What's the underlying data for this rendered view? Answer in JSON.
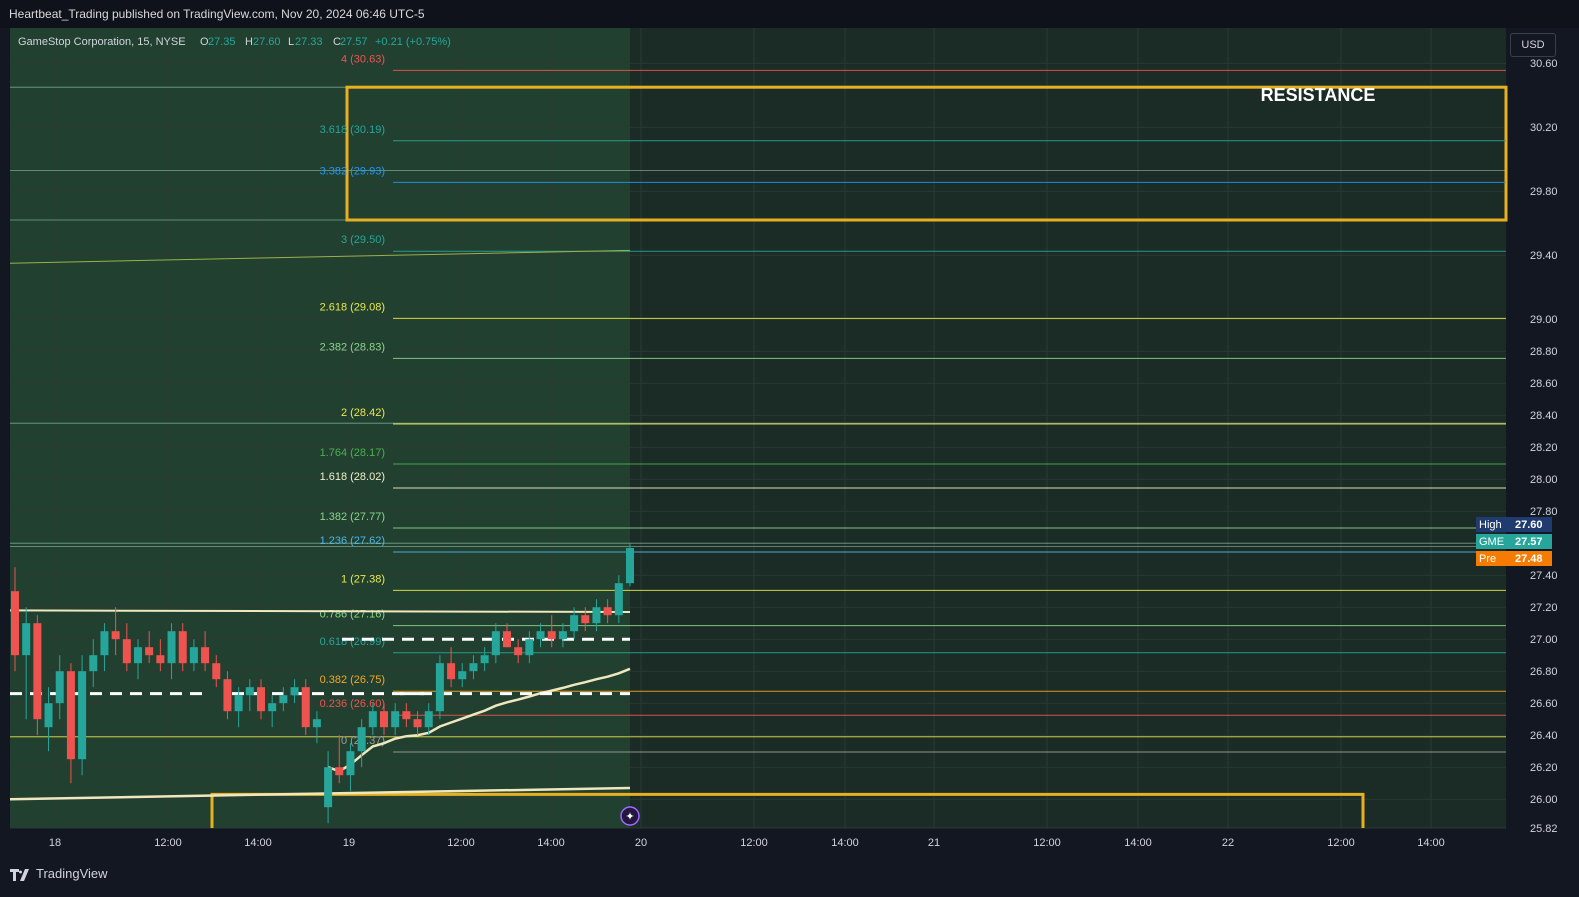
{
  "header": {
    "publisher_line": "Heartbeat_Trading published on TradingView.com, Nov 20, 2024 06:46 UTC-5"
  },
  "legend": {
    "symbol": "GameStop Corporation, 15, NYSE",
    "o_label": "O",
    "o_value": "27.35",
    "h_label": "H",
    "h_value": "27.60",
    "l_label": "L",
    "l_value": "27.33",
    "c_label": "C",
    "c_value": "27.57",
    "change": "+0.21 (+0.75%)"
  },
  "currency_button": "USD",
  "footer": {
    "brand": "TradingView"
  },
  "annotation": {
    "text": "RESISTANCE"
  },
  "colors": {
    "background": "#1b2b26",
    "shade_left": "#224232",
    "up": "#26a69a",
    "down": "#ef5350",
    "box": "#e8b020",
    "vwap": "#efe7bd"
  },
  "chart_data": {
    "type": "candlestick",
    "symbol": "GME",
    "interval": "15",
    "ylim": [
      25.82,
      30.82
    ],
    "y_ticks": [
      "30.60",
      "30.20",
      "29.80",
      "29.40",
      "29.00",
      "28.80",
      "28.60",
      "28.40",
      "28.20",
      "28.00",
      "27.80",
      "27.40",
      "27.20",
      "27.00",
      "26.80",
      "26.60",
      "26.40",
      "26.20",
      "26.00",
      "25.82"
    ],
    "x_ticks": [
      "18",
      "12:00",
      "14:00",
      "19",
      "12:00",
      "14:00",
      "20",
      "12:00",
      "14:00",
      "21",
      "12:00",
      "14:00",
      "22",
      "12:00",
      "14:00"
    ],
    "price_tags": [
      {
        "label": "High",
        "value": "27.60",
        "color": "#1f3b70"
      },
      {
        "label": "GME",
        "value": "27.57",
        "color": "#26a69a"
      },
      {
        "label": "Pre",
        "value": "27.48",
        "color": "#f57c00"
      }
    ],
    "fib_levels": [
      {
        "ratio": "4",
        "price": 30.63,
        "text": "4 (30.63)",
        "color": "#ef5350"
      },
      {
        "ratio": "3.618",
        "price": 30.19,
        "text": "3.618 (30.19)",
        "color": "#26a69a"
      },
      {
        "ratio": "3.382",
        "price": 29.93,
        "text": "3.382 (29.93)",
        "color": "#2196f3"
      },
      {
        "ratio": "3",
        "price": 29.5,
        "text": "3 (29.50)",
        "color": "#26a69a"
      },
      {
        "ratio": "2.618",
        "price": 29.08,
        "text": "2.618 (29.08)",
        "color": "#e8e84a"
      },
      {
        "ratio": "2.382",
        "price": 28.83,
        "text": "2.382 (28.83)",
        "color": "#8bd48b"
      },
      {
        "ratio": "2",
        "price": 28.42,
        "text": "2 (28.42)",
        "color": "#e8e84a"
      },
      {
        "ratio": "1.764",
        "price": 28.17,
        "text": "1.764 (28.17)",
        "color": "#4caf50"
      },
      {
        "ratio": "1.618",
        "price": 28.02,
        "text": "1.618 (28.02)",
        "color": "#f0f0c8"
      },
      {
        "ratio": "1.382",
        "price": 27.77,
        "text": "1.382 (27.77)",
        "color": "#8bd48b"
      },
      {
        "ratio": "1.236",
        "price": 27.62,
        "text": "1.236 (27.62)",
        "color": "#4db6e8"
      },
      {
        "ratio": "1",
        "price": 27.38,
        "text": "1 (27.38)",
        "color": "#e8e84a"
      },
      {
        "ratio": "0.786",
        "price": 27.16,
        "text": "0.786 (27.16)",
        "color": "#8bd48b"
      },
      {
        "ratio": "0.618",
        "price": 26.99,
        "text": "0.618 (26.99)",
        "color": "#26a69a"
      },
      {
        "ratio": "0.382",
        "price": 26.75,
        "text": "0.382 (26.75)",
        "color": "#f5a623"
      },
      {
        "ratio": "0.236",
        "price": 26.6,
        "text": "0.236 (26.60)",
        "color": "#ef5350"
      },
      {
        "ratio": "0",
        "price": 26.37,
        "text": "0 (26.37)",
        "color": "#9e9e9e"
      }
    ],
    "candles": [
      {
        "o": 27.3,
        "h": 27.45,
        "l": 26.8,
        "c": 26.9
      },
      {
        "o": 26.9,
        "h": 27.2,
        "l": 26.5,
        "c": 27.1
      },
      {
        "o": 27.1,
        "h": 27.15,
        "l": 26.4,
        "c": 26.5
      },
      {
        "o": 26.45,
        "h": 26.7,
        "l": 26.3,
        "c": 26.6
      },
      {
        "o": 26.6,
        "h": 26.9,
        "l": 26.5,
        "c": 26.8
      },
      {
        "o": 26.8,
        "h": 26.85,
        "l": 26.1,
        "c": 26.25
      },
      {
        "o": 26.25,
        "h": 26.9,
        "l": 26.15,
        "c": 26.8
      },
      {
        "o": 26.8,
        "h": 27.0,
        "l": 26.7,
        "c": 26.9
      },
      {
        "o": 26.9,
        "h": 27.1,
        "l": 26.8,
        "c": 27.05
      },
      {
        "o": 27.05,
        "h": 27.2,
        "l": 26.9,
        "c": 27.0
      },
      {
        "o": 27.0,
        "h": 27.1,
        "l": 26.8,
        "c": 26.85
      },
      {
        "o": 26.85,
        "h": 27.0,
        "l": 26.75,
        "c": 26.95
      },
      {
        "o": 26.95,
        "h": 27.05,
        "l": 26.85,
        "c": 26.9
      },
      {
        "o": 26.9,
        "h": 27.0,
        "l": 26.8,
        "c": 26.85
      },
      {
        "o": 26.85,
        "h": 27.1,
        "l": 26.75,
        "c": 27.05
      },
      {
        "o": 27.05,
        "h": 27.1,
        "l": 26.8,
        "c": 26.85
      },
      {
        "o": 26.85,
        "h": 27.0,
        "l": 26.8,
        "c": 26.95
      },
      {
        "o": 26.95,
        "h": 27.05,
        "l": 26.8,
        "c": 26.85
      },
      {
        "o": 26.85,
        "h": 26.9,
        "l": 26.7,
        "c": 26.75
      },
      {
        "o": 26.75,
        "h": 26.8,
        "l": 26.5,
        "c": 26.55
      },
      {
        "o": 26.55,
        "h": 26.7,
        "l": 26.45,
        "c": 26.65
      },
      {
        "o": 26.65,
        "h": 26.75,
        "l": 26.55,
        "c": 26.7
      },
      {
        "o": 26.7,
        "h": 26.75,
        "l": 26.5,
        "c": 26.55
      },
      {
        "o": 26.55,
        "h": 26.65,
        "l": 26.45,
        "c": 26.6
      },
      {
        "o": 26.6,
        "h": 26.7,
        "l": 26.55,
        "c": 26.65
      },
      {
        "o": 26.65,
        "h": 26.75,
        "l": 26.6,
        "c": 26.7
      },
      {
        "o": 26.7,
        "h": 26.75,
        "l": 26.4,
        "c": 26.45
      },
      {
        "o": 26.45,
        "h": 26.55,
        "l": 26.35,
        "c": 26.5
      },
      {
        "o": 25.95,
        "h": 26.3,
        "l": 25.85,
        "c": 26.2
      },
      {
        "o": 26.2,
        "h": 26.4,
        "l": 26.1,
        "c": 26.15
      },
      {
        "o": 26.15,
        "h": 26.35,
        "l": 26.05,
        "c": 26.3
      },
      {
        "o": 26.3,
        "h": 26.5,
        "l": 26.2,
        "c": 26.45
      },
      {
        "o": 26.45,
        "h": 26.6,
        "l": 26.4,
        "c": 26.55
      },
      {
        "o": 26.55,
        "h": 26.6,
        "l": 26.4,
        "c": 26.45
      },
      {
        "o": 26.45,
        "h": 26.6,
        "l": 26.4,
        "c": 26.55
      },
      {
        "o": 26.55,
        "h": 26.6,
        "l": 26.45,
        "c": 26.5
      },
      {
        "o": 26.5,
        "h": 26.55,
        "l": 26.4,
        "c": 26.45
      },
      {
        "o": 26.45,
        "h": 26.6,
        "l": 26.4,
        "c": 26.55
      },
      {
        "o": 26.55,
        "h": 26.9,
        "l": 26.5,
        "c": 26.85
      },
      {
        "o": 26.85,
        "h": 26.95,
        "l": 26.7,
        "c": 26.75
      },
      {
        "o": 26.75,
        "h": 26.85,
        "l": 26.7,
        "c": 26.8
      },
      {
        "o": 26.8,
        "h": 26.9,
        "l": 26.75,
        "c": 26.85
      },
      {
        "o": 26.85,
        "h": 26.95,
        "l": 26.8,
        "c": 26.9
      },
      {
        "o": 26.9,
        "h": 27.1,
        "l": 26.85,
        "c": 27.05
      },
      {
        "o": 27.05,
        "h": 27.1,
        "l": 26.95,
        "c": 26.95
      },
      {
        "o": 26.95,
        "h": 27.0,
        "l": 26.85,
        "c": 26.9
      },
      {
        "o": 26.9,
        "h": 27.05,
        "l": 26.85,
        "c": 27.0
      },
      {
        "o": 27.0,
        "h": 27.1,
        "l": 26.95,
        "c": 27.05
      },
      {
        "o": 27.05,
        "h": 27.15,
        "l": 26.95,
        "c": 27.0
      },
      {
        "o": 27.0,
        "h": 27.1,
        "l": 26.95,
        "c": 27.05
      },
      {
        "o": 27.05,
        "h": 27.2,
        "l": 27.0,
        "c": 27.15
      },
      {
        "o": 27.15,
        "h": 27.2,
        "l": 27.05,
        "c": 27.1
      },
      {
        "o": 27.1,
        "h": 27.25,
        "l": 27.05,
        "c": 27.2
      },
      {
        "o": 27.2,
        "h": 27.25,
        "l": 27.1,
        "c": 27.15
      },
      {
        "o": 27.15,
        "h": 27.4,
        "l": 27.1,
        "c": 27.35
      },
      {
        "o": 27.35,
        "h": 27.6,
        "l": 27.33,
        "c": 27.57
      }
    ]
  }
}
